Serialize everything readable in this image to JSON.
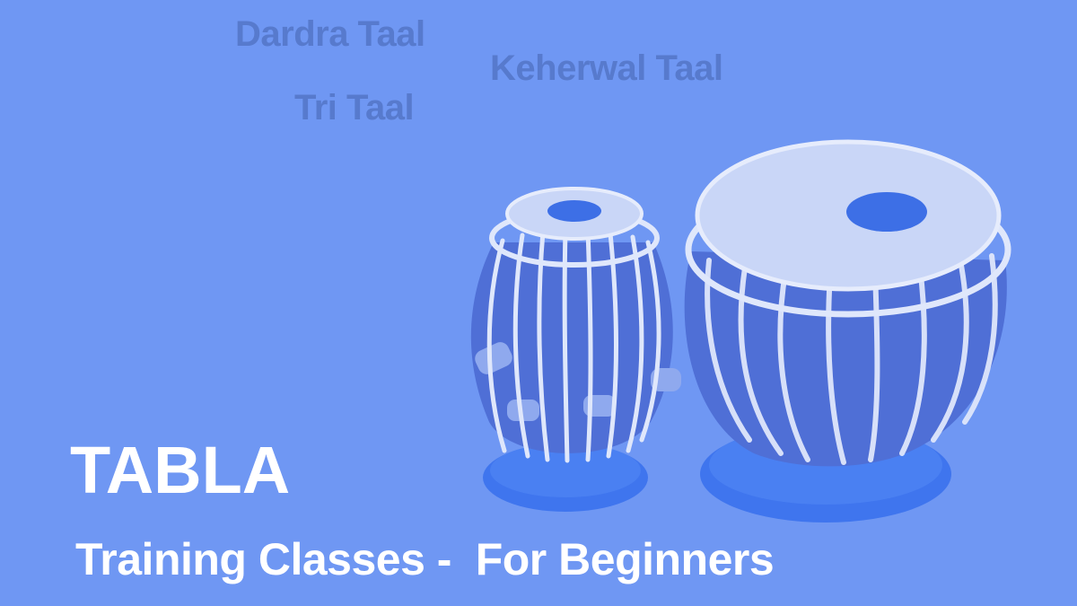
{
  "taals": {
    "dardra": "Dardra Taal",
    "keherwal": "Keherwal Taal",
    "tri": "Tri Taal"
  },
  "title": "TABLA",
  "subtitle": "Training Classes -  For Beginners",
  "colors": {
    "background": "#6f97f3",
    "taal_text": "#5577c9",
    "title_text": "#ffffff",
    "drum_shell": "#4f6fd6",
    "drum_head": "#c9d6f7",
    "drum_strap": "#dfe7fb",
    "cushion": "#3f75ee"
  },
  "icons": {
    "dayan": "tabla-dayan-drum",
    "bayan": "tabla-bayan-drum"
  }
}
